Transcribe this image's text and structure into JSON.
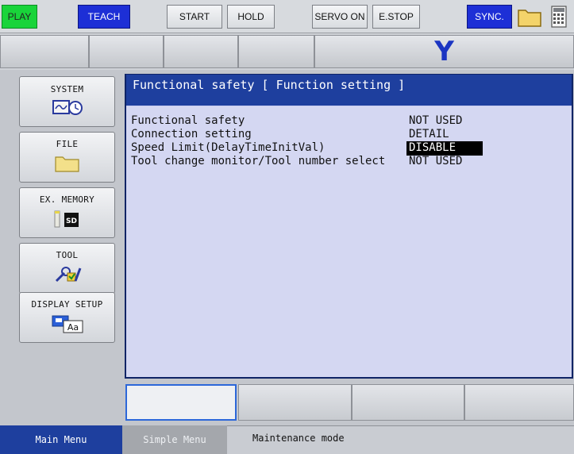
{
  "toolbar": {
    "play": "PLAY",
    "teach": "TEACH",
    "start": "START",
    "hold": "HOLD",
    "servo_on": "SERVO ON",
    "estop": "E.STOP",
    "sync": "SYNC.",
    "colors": {
      "play": "#19d43a",
      "teach": "#1d2fd6",
      "sync": "#1d2fd6"
    }
  },
  "row2": {
    "y_label": "Y"
  },
  "left_menu": [
    {
      "label": "SYSTEM",
      "icon": "system-icon"
    },
    {
      "label": "FILE",
      "icon": "folder-icon"
    },
    {
      "label": "EX. MEMORY",
      "icon": "sd-card-icon"
    },
    {
      "label": "TOOL",
      "icon": "tool-icon"
    },
    {
      "label": "DISPLAY SETUP",
      "icon": "display-setup-icon"
    }
  ],
  "screen": {
    "title": "Functional safety [ Function setting ]",
    "rows": [
      {
        "label": "Functional safety",
        "value": "NOT USED"
      },
      {
        "label": "Connection setting",
        "value": "DETAIL"
      },
      {
        "label": "Speed Limit(DelayTimeInitVal)",
        "value": "DISABLE",
        "selected": true
      },
      {
        "label": "Tool change monitor/Tool number select",
        "value": "NOT USED"
      }
    ]
  },
  "status_bar": {
    "main_menu": "Main Menu",
    "simple_menu": "Simple Menu",
    "mode": "Maintenance mode"
  }
}
